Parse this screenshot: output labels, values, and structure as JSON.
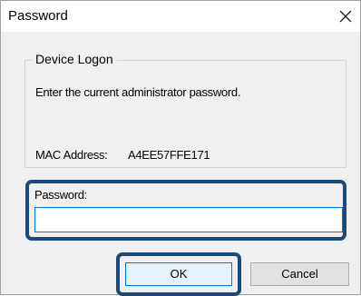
{
  "window": {
    "title": "Password",
    "close_icon": "close-icon"
  },
  "group": {
    "legend": "Device Logon",
    "instruction": "Enter the current administrator password.",
    "mac_label": "MAC Address:",
    "mac_value": "A4EE57FFE171"
  },
  "password": {
    "label": "Password:",
    "value": "",
    "placeholder": ""
  },
  "buttons": {
    "ok": "OK",
    "cancel": "Cancel"
  },
  "colors": {
    "highlight_border": "#1b4a7a",
    "focus_border": "#0078d7",
    "dialog_bg": "#f0f0f0"
  }
}
